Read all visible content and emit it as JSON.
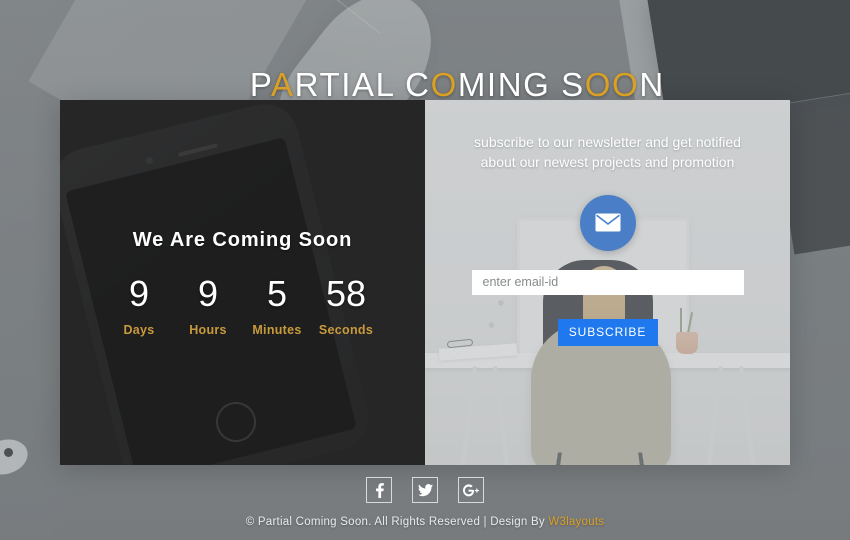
{
  "header": {
    "title_full": "PARTIAL COMING SOON",
    "title_parts": [
      {
        "text": "P",
        "highlight": false
      },
      {
        "text": "A",
        "highlight": true
      },
      {
        "text": "RTIAL C",
        "highlight": false
      },
      {
        "text": "O",
        "highlight": true
      },
      {
        "text": "MING S",
        "highlight": false
      },
      {
        "text": "OO",
        "highlight": true
      },
      {
        "text": "N",
        "highlight": false
      }
    ],
    "accent_color": "#d9a024"
  },
  "left_panel": {
    "heading": "We Are Coming Soon",
    "background_color": "#2a2a2b",
    "countdown": [
      {
        "value": "9",
        "label": "Days"
      },
      {
        "value": "9",
        "label": "Hours"
      },
      {
        "value": "5",
        "label": "Minutes"
      },
      {
        "value": "58",
        "label": "Seconds"
      }
    ],
    "countdown_label_color": "#c89a3c"
  },
  "right_panel": {
    "description": "subscribe to our newsletter and get notified about our newest projects and promotion",
    "mail_icon": "envelope-icon",
    "mail_icon_color": "#4a7fc8",
    "email_placeholder": "enter email-id",
    "email_value": "",
    "subscribe_label": "SUBSCRIBE",
    "subscribe_color": "#1f78ed"
  },
  "footer": {
    "socials": [
      {
        "name": "facebook",
        "glyph": "f"
      },
      {
        "name": "twitter",
        "glyph": "t"
      },
      {
        "name": "google-plus",
        "glyph": "G+"
      }
    ],
    "copyright_prefix": "© Partial Coming Soon. All Rights Reserved | Design By ",
    "brand": "W3layouts",
    "brand_color": "#d9a024"
  }
}
